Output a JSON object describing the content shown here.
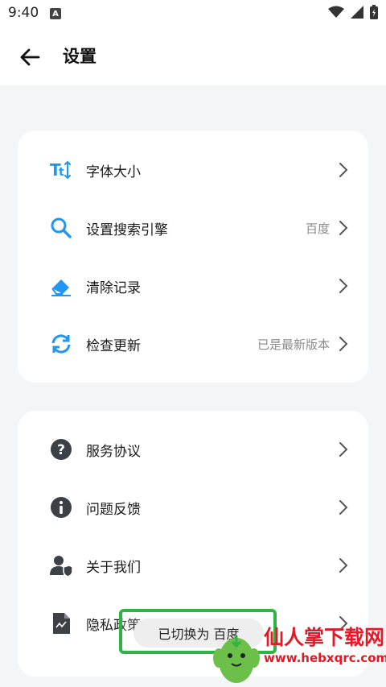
{
  "status_bar": {
    "time": "9:40",
    "notification_badge": "A"
  },
  "header": {
    "title": "设置"
  },
  "card1": {
    "items": [
      {
        "label": "字体大小",
        "value": "",
        "icon": "font-size-icon"
      },
      {
        "label": "设置搜索引擎",
        "value": "百度",
        "icon": "search-icon"
      },
      {
        "label": "清除记录",
        "value": "",
        "icon": "eraser-icon"
      },
      {
        "label": "检查更新",
        "value": "已是最新版本",
        "icon": "refresh-icon"
      }
    ]
  },
  "card2": {
    "items": [
      {
        "label": "服务协议",
        "value": "",
        "icon": "question-circle-icon"
      },
      {
        "label": "问题反馈",
        "value": "",
        "icon": "info-circle-icon"
      },
      {
        "label": "关于我们",
        "value": "",
        "icon": "user-shield-icon"
      },
      {
        "label": "隐私政策",
        "value": "",
        "icon": "document-icon"
      }
    ]
  },
  "toast": {
    "message": "已切换为 百度"
  },
  "watermark": {
    "brand": "仙人掌下载网",
    "url": "www.hebxqrc.com"
  },
  "colors": {
    "accent_blue": "#2196f3",
    "icon_gray": "#3c4148",
    "toast_border": "#2fb344",
    "watermark_red": "#e21a27"
  }
}
